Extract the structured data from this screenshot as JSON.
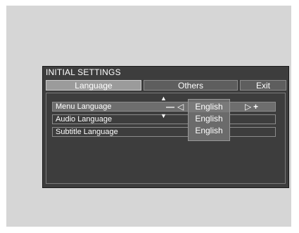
{
  "osd": {
    "title": "INITIAL SETTINGS",
    "tabs": [
      {
        "label": "Language",
        "selected": true
      },
      {
        "label": "Others",
        "selected": false
      },
      {
        "label": "Exit",
        "selected": false
      }
    ],
    "rows": [
      {
        "label": "Menu Language",
        "value": "English",
        "selected": true
      },
      {
        "label": "Audio Language",
        "value": "English",
        "selected": false
      },
      {
        "label": "Subtitle Language",
        "value": "English",
        "selected": false
      }
    ],
    "controls": {
      "decrease": "—",
      "increase": "+",
      "prev": "◁",
      "next": "▷",
      "up": "▲",
      "down": "▼"
    }
  }
}
